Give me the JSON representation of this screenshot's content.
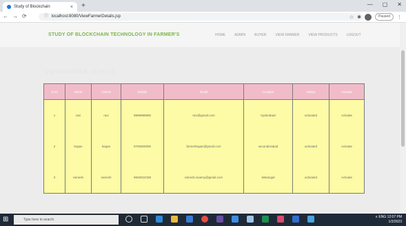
{
  "browser": {
    "tab_title": "Study of Blockchain",
    "close_symbol": "×",
    "newtab_symbol": "+",
    "url": "localhost:8080/ViewFarmerDetails.jsp",
    "nav": [
      "←",
      "→",
      "⟳"
    ],
    "window_controls": [
      "—",
      "▢",
      "✕"
    ],
    "profile_pill": "Paused"
  },
  "site": {
    "brand": "STUDY OF BLOCKCHAIN TECHNOLOGY IN FARMER'S",
    "menu": [
      "HOME",
      "ADMIN",
      "BUYER",
      "VIEW FARMER",
      "VIEW PRODUCTS",
      "LOGOUT"
    ],
    "subtitle": "VIEW FARMER DETAILS"
  },
  "table": {
    "headers": [
      "S.No",
      "Name",
      "UserId",
      "Mobile",
      "Email",
      "Location",
      "Status",
      "Activate"
    ],
    "rows": [
      [
        "1",
        "ravi",
        "ravi",
        "9999999990",
        "ravi@gmail.com",
        "hyderabad",
        "activated",
        "Activate"
      ],
      [
        "2",
        "kegan",
        "kegan",
        "9700000000",
        "farmerkegan@gmail.com",
        "secunderabad",
        "activated",
        "Activate"
      ],
      [
        "3",
        "ramesh",
        "ramesh",
        "9848022338",
        "ramesh.swamy@gmail.com",
        "Warangal",
        "activated",
        "Activate"
      ]
    ]
  },
  "taskbar": {
    "search_placeholder": "Type here to search",
    "start_glyph": "⊞",
    "time": "12:07 PM",
    "date": "1/2/2023",
    "tray": "∧  ENG"
  },
  "colors": {
    "brand_green": "#7ab648",
    "header_pink": "#f1bcc9",
    "table_yellow": "#fdfba5",
    "taskbar": "#1f2a38"
  }
}
